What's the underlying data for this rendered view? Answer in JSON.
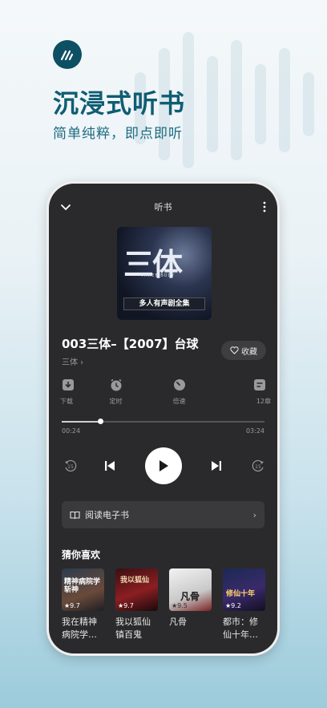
{
  "promo": {
    "headline": "沉浸式听书",
    "subheadline": "简单纯粹，即点即听"
  },
  "player": {
    "header_title": "听书",
    "cover_text": "三体",
    "cover_banner": "多人有声剧全集",
    "cover_tag": "THREE BODY",
    "track_title": "003三体–【2007】台球",
    "book_link": "三体 ›",
    "favorite_label": "收藏",
    "actions": [
      {
        "label": "下载",
        "icon": "download-icon"
      },
      {
        "label": "定时",
        "icon": "timer-icon"
      },
      {
        "label": "倍速",
        "icon": "speed-icon"
      },
      {
        "label": "12章",
        "icon": "chapters-icon"
      }
    ],
    "progress": {
      "elapsed": "00:24",
      "total": "03:24",
      "fraction": 0.19
    },
    "skip_back_seconds": "15",
    "skip_forward_seconds": "15",
    "ebook_label": "阅读电子书",
    "ebook_chevron": "›"
  },
  "recommendations": {
    "title": "猜你喜欢",
    "items": [
      {
        "name": "我在精神病院学…",
        "score": "★9.7",
        "cover_text": "精神病院学斩神"
      },
      {
        "name": "我以狐仙镇百鬼",
        "score": "★9.7",
        "cover_text": "我以狐仙"
      },
      {
        "name": "凡骨",
        "score": "★9.5",
        "cover_text": "凡骨"
      },
      {
        "name": "都市：修仙十年…",
        "score": "★9.2",
        "cover_text": "修仙十年"
      }
    ]
  },
  "colors": {
    "brand": "#0f5d73",
    "player_bg": "#2a2a2c"
  }
}
